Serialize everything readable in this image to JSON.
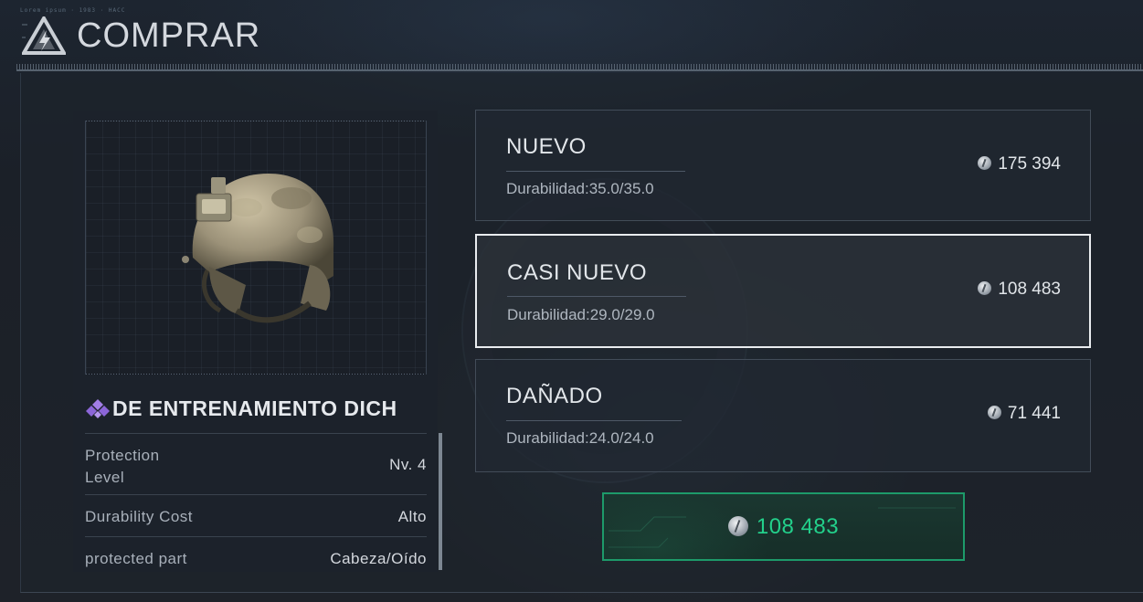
{
  "header": {
    "title": "COMPRAR",
    "caption": "Lorem ipsum · 1983 · HACC"
  },
  "item": {
    "name": "DE ENTRENAMIENTO DICH",
    "rarity_color": "#a27ee6",
    "stats": [
      {
        "label": "Protection\nLevel",
        "value": "Nv. 4"
      },
      {
        "label": "Durability Cost",
        "value": "Alto"
      },
      {
        "label": "protected part",
        "value": "Cabeza/Oído"
      }
    ]
  },
  "options": [
    {
      "name": "NUEVO",
      "durability": "Durabilidad:35.0/35.0",
      "price": "175 394",
      "selected": false
    },
    {
      "name": "CASI NUEVO",
      "durability": "Durabilidad:29.0/29.0",
      "price": "108 483",
      "selected": true
    },
    {
      "name": "DAÑADO",
      "durability": "Durabilidad:24.0/24.0",
      "price": "71 441",
      "selected": false
    }
  ],
  "buy": {
    "price": "108 483",
    "accent_color": "#23d08b"
  },
  "colors": {
    "background": "#1a2029",
    "selected_border": "#e9ecef"
  }
}
